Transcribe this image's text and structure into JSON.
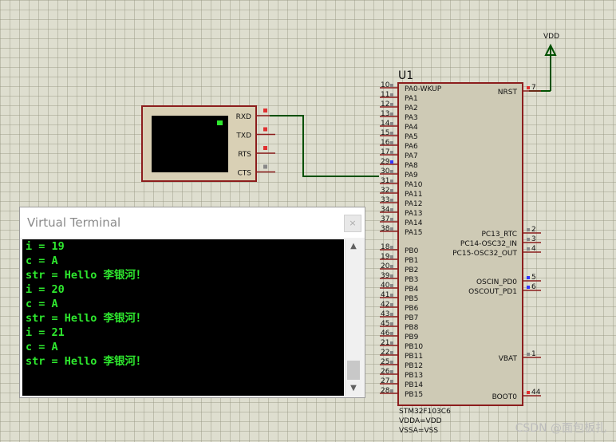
{
  "power": {
    "label": "VDD"
  },
  "terminal_device": {
    "pins": [
      "RXD",
      "TXD",
      "RTS",
      "CTS"
    ],
    "pin_colors": [
      "#e03030",
      "#e03030",
      "#e03030",
      "#888888"
    ]
  },
  "mcu": {
    "ref": "U1",
    "part": "STM32F103C6",
    "props": [
      "VDDA=VDD",
      "VSSA=VSS"
    ],
    "left_pins": [
      {
        "num": "10",
        "name": "PA0-WKUP"
      },
      {
        "num": "11",
        "name": "PA1"
      },
      {
        "num": "12",
        "name": "PA2"
      },
      {
        "num": "13",
        "name": "PA3"
      },
      {
        "num": "14",
        "name": "PA4"
      },
      {
        "num": "15",
        "name": "PA5"
      },
      {
        "num": "16",
        "name": "PA6"
      },
      {
        "num": "17",
        "name": "PA7"
      },
      {
        "num": "29",
        "name": "PA8"
      },
      {
        "num": "30",
        "name": "PA9"
      },
      {
        "num": "31",
        "name": "PA10"
      },
      {
        "num": "32",
        "name": "PA11"
      },
      {
        "num": "33",
        "name": "PA12"
      },
      {
        "num": "34",
        "name": "PA13"
      },
      {
        "num": "37",
        "name": "PA14"
      },
      {
        "num": "38",
        "name": "PA15"
      },
      {
        "num": "18",
        "name": "PB0"
      },
      {
        "num": "19",
        "name": "PB1"
      },
      {
        "num": "20",
        "name": "PB2"
      },
      {
        "num": "39",
        "name": "PB3"
      },
      {
        "num": "40",
        "name": "PB4"
      },
      {
        "num": "41",
        "name": "PB5"
      },
      {
        "num": "42",
        "name": "PB6"
      },
      {
        "num": "43",
        "name": "PB7"
      },
      {
        "num": "45",
        "name": "PB8"
      },
      {
        "num": "46",
        "name": "PB9"
      },
      {
        "num": "21",
        "name": "PB10"
      },
      {
        "num": "22",
        "name": "PB11"
      },
      {
        "num": "25",
        "name": "PB12"
      },
      {
        "num": "26",
        "name": "PB13"
      },
      {
        "num": "27",
        "name": "PB14"
      },
      {
        "num": "28",
        "name": "PB15"
      }
    ],
    "right_pins": [
      {
        "num": "7",
        "name": "NRST"
      },
      {
        "num": "2",
        "name": "PC13_RTC"
      },
      {
        "num": "3",
        "name": "PC14-OSC32_IN"
      },
      {
        "num": "4",
        "name": "PC15-OSC32_OUT"
      },
      {
        "num": "5",
        "name": "OSCIN_PD0"
      },
      {
        "num": "6",
        "name": "OSCOUT_PD1"
      },
      {
        "num": "1",
        "name": "VBAT"
      },
      {
        "num": "44",
        "name": "BOOT0"
      }
    ]
  },
  "virtual_terminal": {
    "title": "Virtual Terminal",
    "close_label": "×",
    "lines": [
      "i = 19",
      "c = A",
      "str = Hello 李银河！",
      "i = 20",
      "c = A",
      "str = Hello 李银河！",
      "i = 21",
      "c = A",
      "str = Hello 李银河！"
    ],
    "text_color": "#2ee82e"
  },
  "watermark": "CSDN @面包板扎"
}
